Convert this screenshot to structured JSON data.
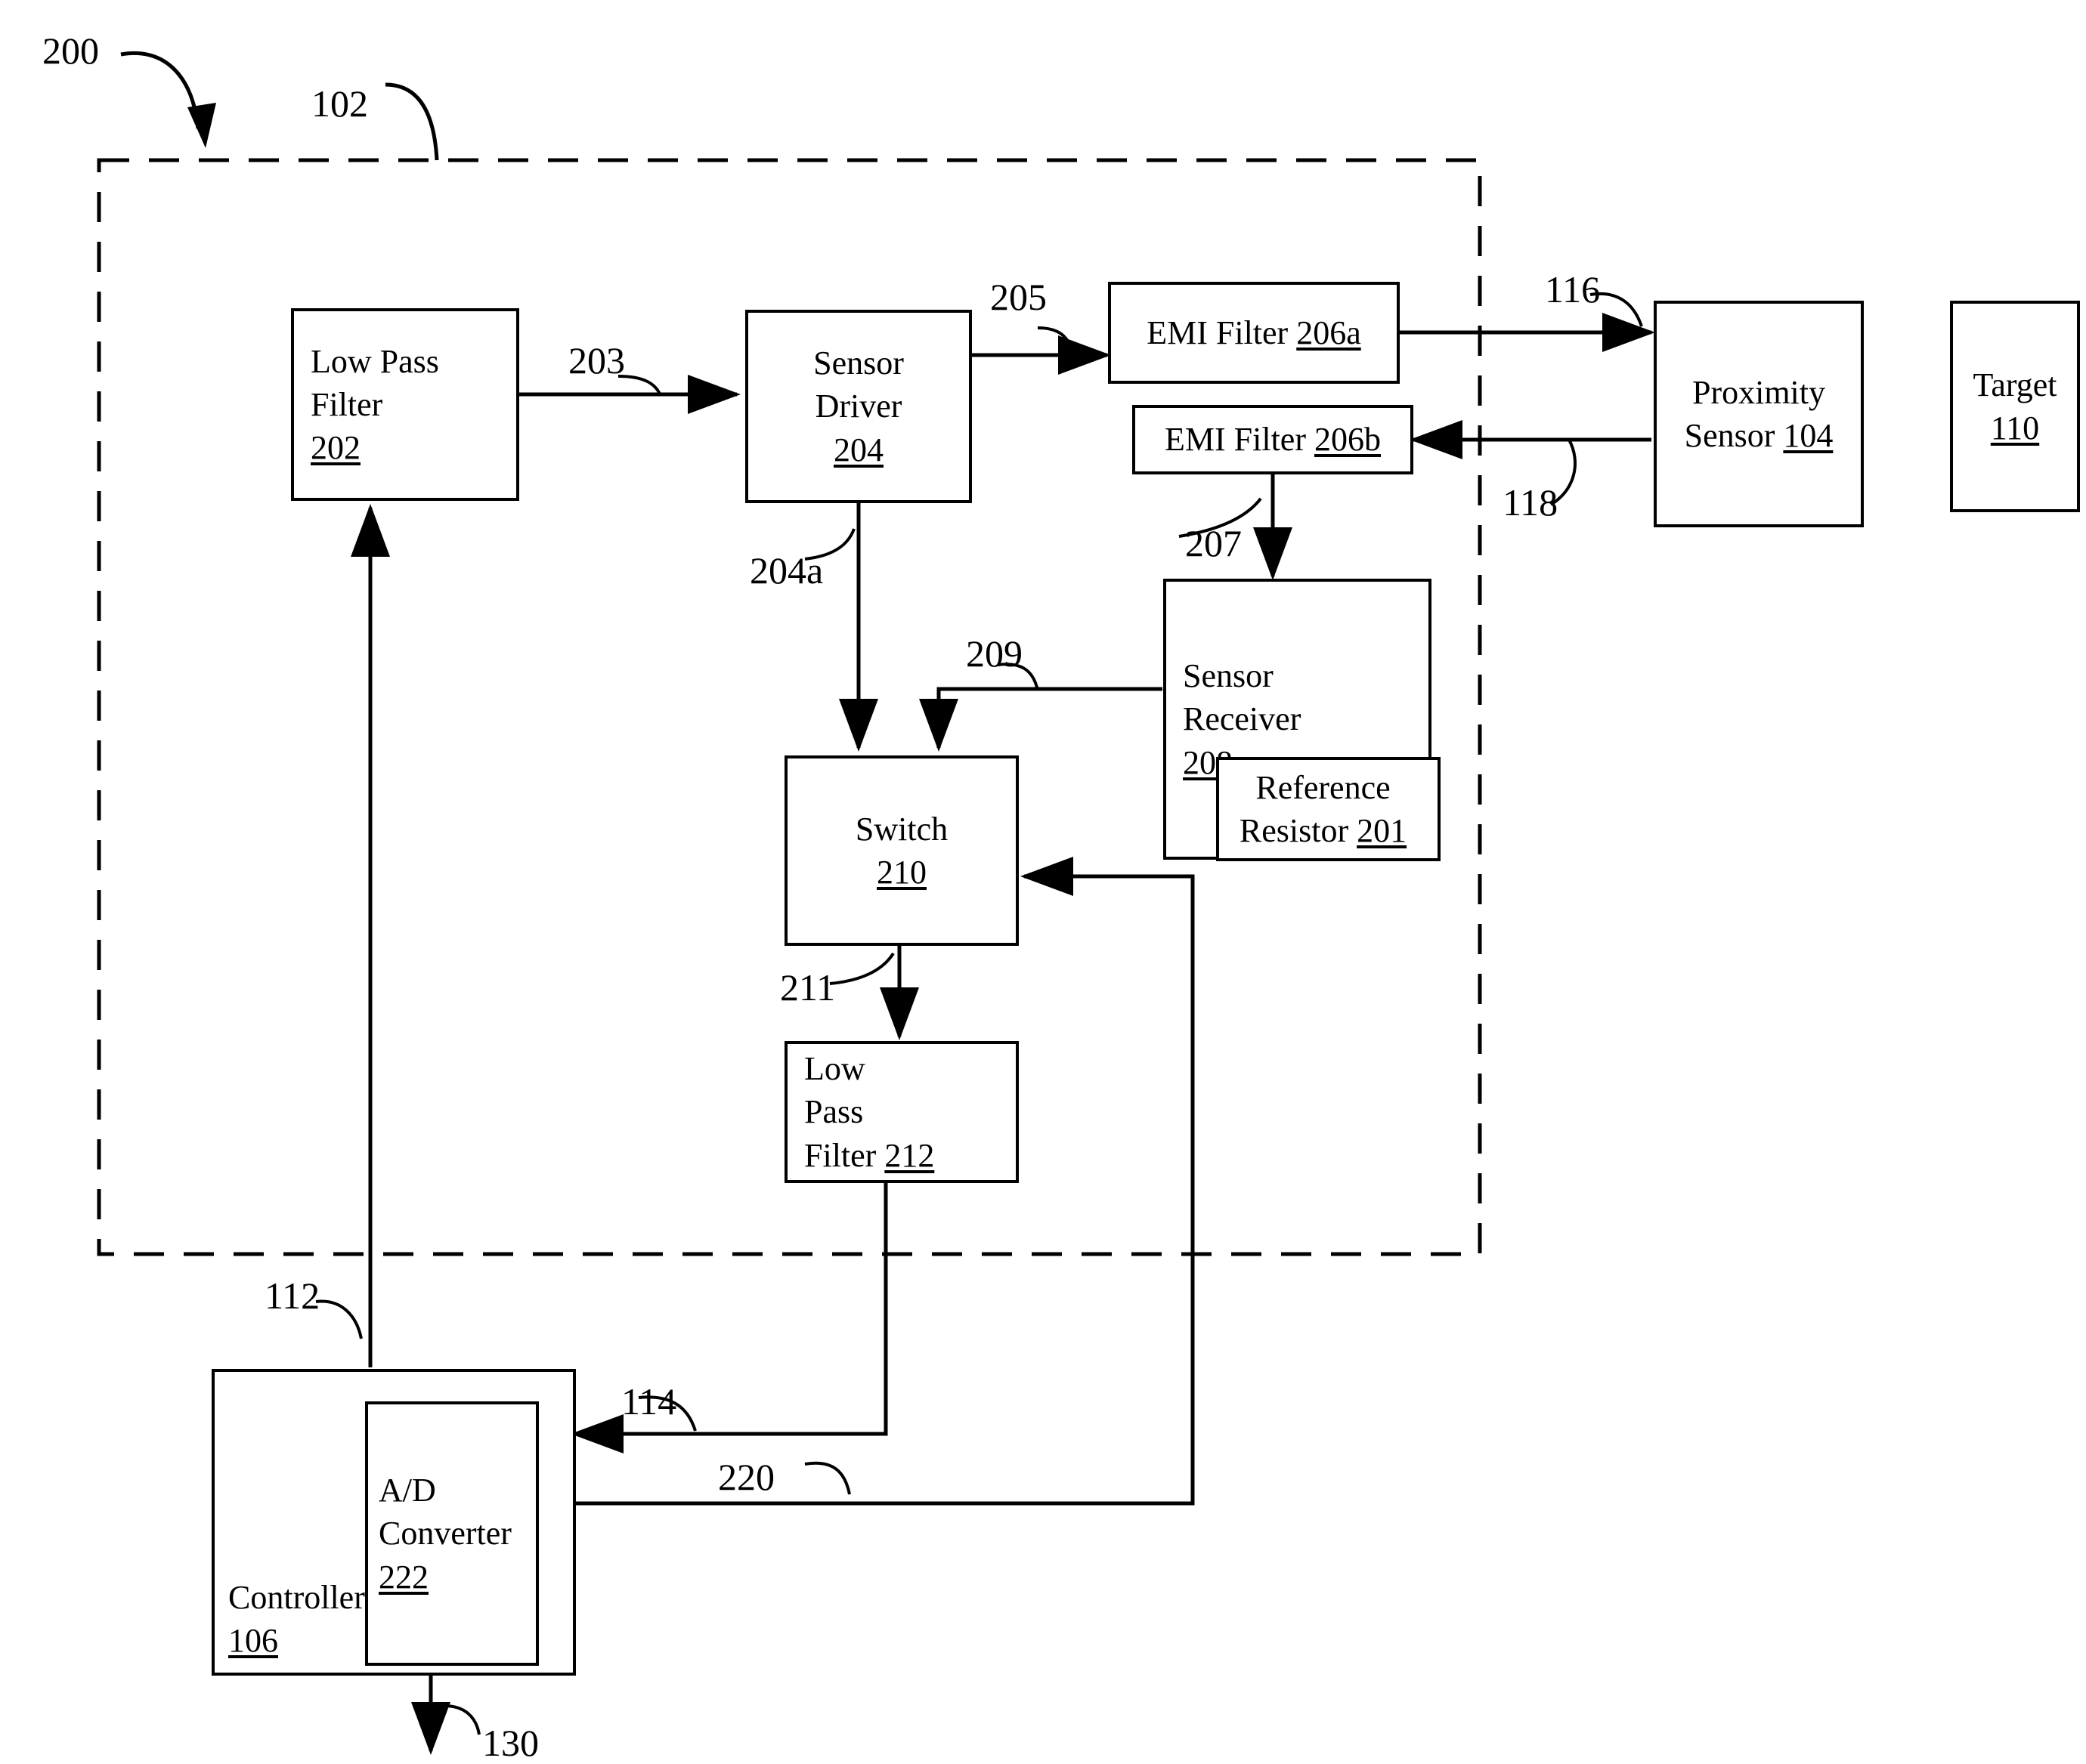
{
  "figure": {
    "number": "200",
    "sensor_circuit_ref": "102"
  },
  "blocks": {
    "low_pass_filter_202": {
      "line1": "Low Pass",
      "line2": "Filter",
      "ref": "202"
    },
    "sensor_driver_204": {
      "line1": "Sensor",
      "line2": "Driver",
      "ref": "204"
    },
    "emi_filter_206a": {
      "line1": "EMI Filter ",
      "ref": "206a"
    },
    "emi_filter_206b": {
      "line1": "EMI Filter ",
      "ref": "206b"
    },
    "proximity_sensor_104": {
      "line1": "Proximity",
      "line2": "Sensor ",
      "ref": "104"
    },
    "target_110": {
      "line1": "Target",
      "ref": "110"
    },
    "sensor_receiver_208": {
      "line1": "Sensor",
      "line2": "Receiver",
      "ref": "208"
    },
    "reference_resistor_201": {
      "line1": "Reference",
      "line2": "Resistor ",
      "ref": "201"
    },
    "switch_210": {
      "line1": "Switch",
      "ref": "210"
    },
    "low_pass_filter_212": {
      "line1": "Low",
      "line2": "Pass",
      "line3": "Filter ",
      "ref": "212"
    },
    "controller_106": {
      "line1": "Controller",
      "ref": "106"
    },
    "ad_converter_222": {
      "line1": "A/D",
      "line2": "Converter",
      "ref": "222"
    }
  },
  "signal_labels": {
    "s203": "203",
    "s204a": "204a",
    "s205": "205",
    "s207": "207",
    "s209": "209",
    "s211": "211",
    "s112": "112",
    "s114": "114",
    "s116": "116",
    "s118": "118",
    "s130": "130",
    "s220": "220"
  },
  "colors": {
    "stroke": "#000000",
    "background": "#ffffff"
  }
}
